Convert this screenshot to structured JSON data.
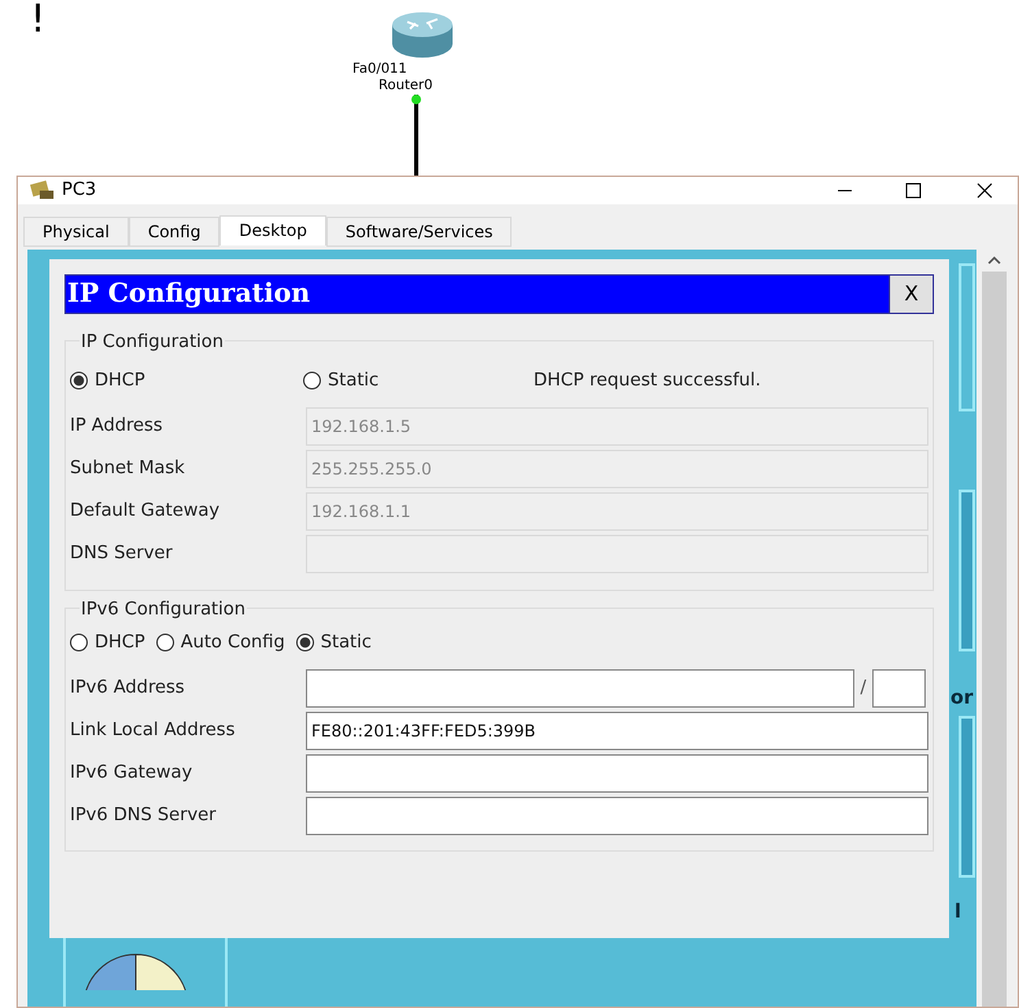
{
  "background_text": "!",
  "topology": {
    "port_label": "Fa0/011",
    "device_label": "Router0",
    "link_up": true
  },
  "window": {
    "title": "PC3"
  },
  "tabs": [
    {
      "label": "Physical",
      "selected": false
    },
    {
      "label": "Config",
      "selected": false
    },
    {
      "label": "Desktop",
      "selected": true
    },
    {
      "label": "Software/Services",
      "selected": false
    }
  ],
  "desktop_partial_labels": [
    "or",
    "l"
  ],
  "dialog": {
    "title": "IP Configuration",
    "close": "X",
    "ipv4": {
      "legend": "IP Configuration",
      "modes": [
        {
          "label": "DHCP",
          "selected": true
        },
        {
          "label": "Static",
          "selected": false
        }
      ],
      "message": "DHCP request successful.",
      "fields": [
        {
          "label": "IP Address",
          "value": "192.168.1.5",
          "disabled": true
        },
        {
          "label": "Subnet Mask",
          "value": "255.255.255.0",
          "disabled": true
        },
        {
          "label": "Default Gateway",
          "value": "192.168.1.1",
          "disabled": true
        },
        {
          "label": "DNS Server",
          "disabled": true
        }
      ]
    },
    "ipv6": {
      "legend": "IPv6 Configuration",
      "modes": [
        {
          "label": "DHCP",
          "selected": false
        },
        {
          "label": "Auto Config",
          "selected": false
        },
        {
          "label": "Static",
          "selected": true
        }
      ],
      "fields": [
        {
          "label": "IPv6 Address",
          "disabled": false,
          "kind": "prefix",
          "separator": "/"
        },
        {
          "label": "Link Local Address",
          "value": "FE80::201:43FF:FED5:399B",
          "disabled": false,
          "kind": "plain"
        },
        {
          "label": "IPv6 Gateway",
          "disabled": false,
          "kind": "plain"
        },
        {
          "label": "IPv6 DNS Server",
          "disabled": false,
          "kind": "plain"
        }
      ]
    }
  }
}
